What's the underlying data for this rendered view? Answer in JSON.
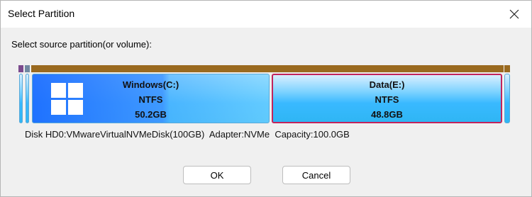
{
  "dialog": {
    "title": "Select Partition",
    "prompt": "Select source partition(or volume):",
    "disk_info": "Disk HD0:VMwareVirtualNVMeDisk(100GB)  Adapter:NVMe  Capacity:100.0GB",
    "ok_label": "OK",
    "cancel_label": "Cancel"
  },
  "partitions": [
    {
      "name": "Windows(C:)",
      "fs": "NTFS",
      "size": "50.2GB",
      "icon": "windows-logo-icon"
    },
    {
      "name": "Data(E:)",
      "fs": "NTFS",
      "size": "48.8GB",
      "selected": true
    }
  ],
  "colors": {
    "partition_band": "#9a6a1f",
    "selected_border": "#c2245c",
    "partition_fill": "#39b9ff"
  }
}
